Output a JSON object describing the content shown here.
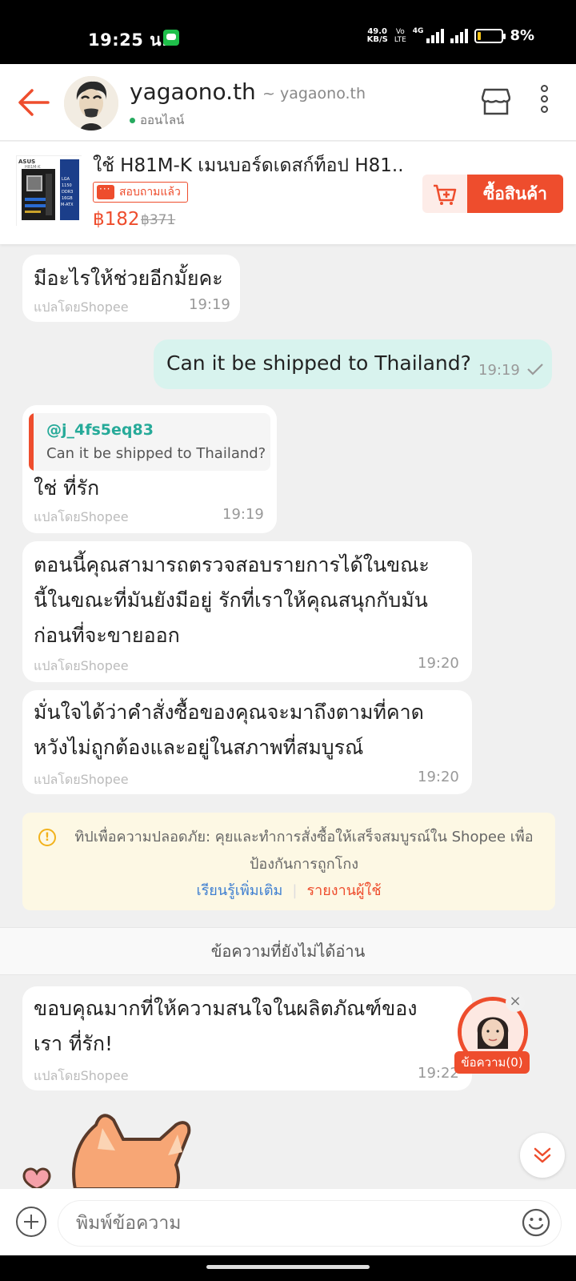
{
  "status_bar": {
    "time": "19:25 น.",
    "net_speed_top": "49.0",
    "net_speed_bottom": "KB/S",
    "volte_top": "Vo",
    "volte_bottom": "LTE",
    "lte_label": "4G",
    "battery_percent": "8%",
    "battery_level": 0.08
  },
  "header": {
    "shop_name": "yagaono.th",
    "shop_handle": "~ yagaono.th",
    "status": "ออนไลน์"
  },
  "product": {
    "title": "ใช้ H81M-K เมนบอร์ดเดสก์ท็อป H81...",
    "asked_tag": "สอบถามแล้ว",
    "price": "฿182",
    "old_price": "฿371",
    "buy_label": "ซื้อสินค้า",
    "image_text": {
      "brand": "ASUS",
      "model": "H81M-K",
      "specs": [
        "LGA",
        "1150",
        "DDR3",
        "16GB",
        "M-ATX"
      ]
    }
  },
  "messages": [
    {
      "type": "received",
      "text": "มีอะไรให้ช่วยอีกมั้ยคะ",
      "translated_by": "แปลโดยShopee",
      "time": "19:19"
    },
    {
      "type": "sent",
      "text": "Can it be shipped to Thailand?",
      "time": "19:19",
      "read": true
    },
    {
      "type": "received",
      "quote_name": "@j_4fs5eq83",
      "quote_text": "Can it be shipped to Thailand?",
      "text": "ใช่ ที่รัก",
      "translated_by": "แปลโดยShopee",
      "time": "19:19"
    },
    {
      "type": "received",
      "lines": [
        "ตอนนี้คุณสามารถตรวจสอบรายการได้ในขณะ",
        "นี้ในขณะที่มันยังมีอยู่ รักที่เราให้คุณสนุกกับมัน",
        "ก่อนที่จะขายออก"
      ],
      "translated_by": "แปลโดยShopee",
      "time": "19:20"
    },
    {
      "type": "received",
      "lines": [
        "มั่นใจได้ว่าคำสั่งซื้อของคุณจะมาถึงตามที่คาด",
        "หวังไม่ถูกต้องและอยู่ในสภาพที่สมบูรณ์"
      ],
      "translated_by": "แปลโดยShopee",
      "time": "19:20"
    },
    {
      "type": "received",
      "lines": [
        "ขอบคุณมากที่ให้ความสนใจในผลิตภัณฑ์ของ",
        "เรา ที่รัก!"
      ],
      "translated_by": "แปลโดยShopee",
      "time": "19:22"
    }
  ],
  "tip": {
    "text": "ทิปเพื่อความปลอดภัย: คุยและทำการสั่งซื้อให้เสร็จสมบูรณ์ใน Shopee เพื่อป้องกันการถูกโกง",
    "learn_more": "เรียนรู้เพิ่มเติม",
    "report": "รายงานผู้ใช้"
  },
  "unread_divider": "ข้อความที่ยังไม่ได้อ่าน",
  "agent": {
    "label": "ข้อความ(0)"
  },
  "input": {
    "placeholder": "พิมพ์ข้อความ"
  },
  "colors": {
    "brand": "#ee4d2d",
    "sent_bubble": "#d8f3ee",
    "online": "#26aa5f",
    "quote_name": "#26aa99",
    "link": "#3f7fd1"
  }
}
